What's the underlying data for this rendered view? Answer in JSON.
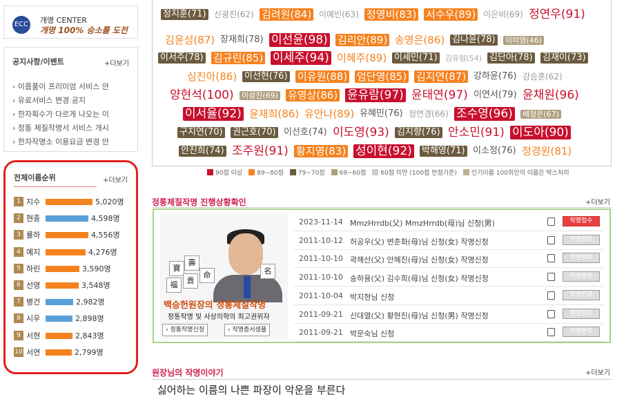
{
  "logo": {
    "emblem": "ECC",
    "line1": "개명 CENTER",
    "line2": "개명 100% 승소를 도전"
  },
  "notice": {
    "title": "공지사항/이벤트",
    "more": "+더보기",
    "items": [
      "이름풀이 프리미엄 서비스 안",
      "유료서비스 변경 공지",
      "한자획수가 다르게 나오는 이",
      "정통 체질작명서 서비스 개시",
      "한자작명소 이용요금 변경 안"
    ]
  },
  "ranking": {
    "title": "전체이름순위",
    "more": "+더보기",
    "items": [
      {
        "rank": "1",
        "name": "지수",
        "count": "5,020명",
        "value": 5020,
        "color": "#f5821f"
      },
      {
        "rank": "2",
        "name": "현종",
        "count": "4,598명",
        "value": 4598,
        "color": "#5aa0d8"
      },
      {
        "rank": "3",
        "name": "률하",
        "count": "4,556명",
        "value": 4556,
        "color": "#f5821f"
      },
      {
        "rank": "4",
        "name": "예지",
        "count": "4,276명",
        "value": 4276,
        "color": "#f5821f"
      },
      {
        "rank": "5",
        "name": "하린",
        "count": "3,590명",
        "value": 3590,
        "color": "#f5821f"
      },
      {
        "rank": "6",
        "name": "선영",
        "count": "3,548명",
        "value": 3548,
        "color": "#f5821f"
      },
      {
        "rank": "7",
        "name": "병건",
        "count": "2,982명",
        "value": 2982,
        "color": "#5aa0d8"
      },
      {
        "rank": "8",
        "name": "시우",
        "count": "2,898명",
        "value": 2898,
        "color": "#5aa0d8"
      },
      {
        "rank": "9",
        "name": "서현",
        "count": "2,843명",
        "value": 2843,
        "color": "#f5821f"
      },
      {
        "rank": "10",
        "name": "서연",
        "count": "2,799명",
        "value": 2799,
        "color": "#f5821f"
      }
    ]
  },
  "cloud": [
    [
      {
        "t": "정지훈(71)",
        "c": "a"
      },
      {
        "t": "신광진(62)",
        "c": "e"
      },
      {
        "t": "김려원(84)",
        "c": "B"
      },
      {
        "t": "이예빈(63)",
        "c": "e"
      },
      {
        "t": "정영비(83)",
        "c": "B"
      },
      {
        "t": "서수우(89)",
        "c": "B"
      },
      {
        "t": "이은비(69)",
        "c": "e"
      },
      {
        "t": "정연우(91)",
        "c": "r"
      }
    ],
    [
      {
        "t": "김윤성(87)",
        "c": "o"
      },
      {
        "t": "장재희(78)",
        "c": "d"
      },
      {
        "t": "이선윤(98)",
        "c": "R"
      },
      {
        "t": "김리안(89)",
        "c": "B"
      },
      {
        "t": "송영은(86)",
        "c": "o"
      },
      {
        "t": "김나윤(78)",
        "c": "a"
      },
      {
        "t": "이미영(46)",
        "c": "f"
      }
    ],
    [
      {
        "t": "이서주(78)",
        "c": "a"
      },
      {
        "t": "김규린(85)",
        "c": "B"
      },
      {
        "t": "이세주(94)",
        "c": "R"
      },
      {
        "t": "이혜주(89)",
        "c": "o"
      },
      {
        "t": "이세민(71)",
        "c": "a"
      },
      {
        "t": "김유림(54)",
        "c": "g"
      },
      {
        "t": "김단아(78)",
        "c": "a"
      },
      {
        "t": "김재이(73)",
        "c": "a"
      }
    ],
    [
      {
        "t": "심진아(86)",
        "c": "o"
      },
      {
        "t": "이선현(76)",
        "c": "a"
      },
      {
        "t": "이유원(88)",
        "c": "B"
      },
      {
        "t": "엄단영(85)",
        "c": "B"
      },
      {
        "t": "김지연(87)",
        "c": "B"
      },
      {
        "t": "강하윤(76)",
        "c": "d"
      },
      {
        "t": "강승훈(62)",
        "c": "e"
      }
    ],
    [
      {
        "t": "양현석(100)",
        "c": "r"
      },
      {
        "t": "이성진(69)",
        "c": "f"
      },
      {
        "t": "유영상(86)",
        "c": "B"
      },
      {
        "t": "윤유람(97)",
        "c": "R"
      },
      {
        "t": "윤태연(97)",
        "c": "r"
      },
      {
        "t": "이연서(79)",
        "c": "d"
      },
      {
        "t": "윤채원(96)",
        "c": "r"
      }
    ],
    [
      {
        "t": "이서율(92)",
        "c": "R"
      },
      {
        "t": "윤재희(86)",
        "c": "o"
      },
      {
        "t": "유안나(89)",
        "c": "o"
      },
      {
        "t": "유혜민(76)",
        "c": "d"
      },
      {
        "t": "정연경(66)",
        "c": "e"
      },
      {
        "t": "조수영(96)",
        "c": "R"
      },
      {
        "t": "배정은(67)",
        "c": "f"
      }
    ],
    [
      {
        "t": "구지연(70)",
        "c": "a"
      },
      {
        "t": "권근호(70)",
        "c": "a"
      },
      {
        "t": "이선호(74)",
        "c": "d"
      },
      {
        "t": "이도영(93)",
        "c": "r"
      },
      {
        "t": "김지향(76)",
        "c": "a"
      },
      {
        "t": "안소민(91)",
        "c": "r"
      },
      {
        "t": "이도아(90)",
        "c": "R"
      }
    ],
    [
      {
        "t": "안진희(74)",
        "c": "a"
      },
      {
        "t": "조주원(91)",
        "c": "r"
      },
      {
        "t": "황지영(83)",
        "c": "B"
      },
      {
        "t": "성이현(92)",
        "c": "R"
      },
      {
        "t": "박해영(71)",
        "c": "a"
      },
      {
        "t": "이소정(76)",
        "c": "d"
      },
      {
        "t": "정경원(81)",
        "c": "o"
      }
    ]
  ],
  "legend": [
    {
      "label": "90점 이상",
      "color": "#c8102e"
    },
    {
      "label": "89~80점",
      "color": "#f5821f"
    },
    {
      "label": "79~70점",
      "color": "#6b5a3e"
    },
    {
      "label": "69~60점",
      "color": "#b0a080"
    },
    {
      "label": "60점 미만 (100점 만점기준)",
      "color": "#cccccc"
    },
    {
      "label": "인기이름 100위안의 이름은 박스처리",
      "color": "#c0b090"
    }
  ],
  "progress": {
    "title": "정통체질작명 진행상황확인",
    "more": "+더보기",
    "slogan": "백승헌원장의 정통체질작명",
    "subtitle": "정통작명 및 사상의학의 최고권위자",
    "btn1": "› 정통작명신청",
    "btn2": "› 작명증서샘플",
    "dice": [
      "寶",
      "壽",
      "福",
      "貴",
      "命",
      "名"
    ],
    "rows": [
      {
        "date": "2023-11-14",
        "text": "MmzHrrdb(父) MmzHrrdb(母)님 신청(男)",
        "status": "작명접수",
        "active": true
      },
      {
        "date": "2011-10-12",
        "text": "허공우(父) 변춘화(母)님 신청(女) 작명신청",
        "status": "작명완료",
        "active": false
      },
      {
        "date": "2011-10-10",
        "text": "곽해산(父) 안혜진(母)님 신청(女) 작명신청",
        "status": "작명완료",
        "active": false
      },
      {
        "date": "2011-10-10",
        "text": "송하용(父) 김수희(母)님 신청(女) 작명신청",
        "status": "작명완료",
        "active": false
      },
      {
        "date": "2011-10-04",
        "text": "박지현님 신청",
        "status": "작명완료",
        "active": false
      },
      {
        "date": "2011-09-21",
        "text": "신대열(父) 황현진(母)님 신청(男) 작명신청",
        "status": "작명완료",
        "active": false
      },
      {
        "date": "2011-09-21",
        "text": "박문숙님 신청",
        "status": "작명완료",
        "active": false
      }
    ]
  },
  "story": {
    "title": "원장님의 작명이야기",
    "more": "+더보기",
    "headline": "싫어하는 이름의 나쁜 파장이 악운을 부른다"
  }
}
